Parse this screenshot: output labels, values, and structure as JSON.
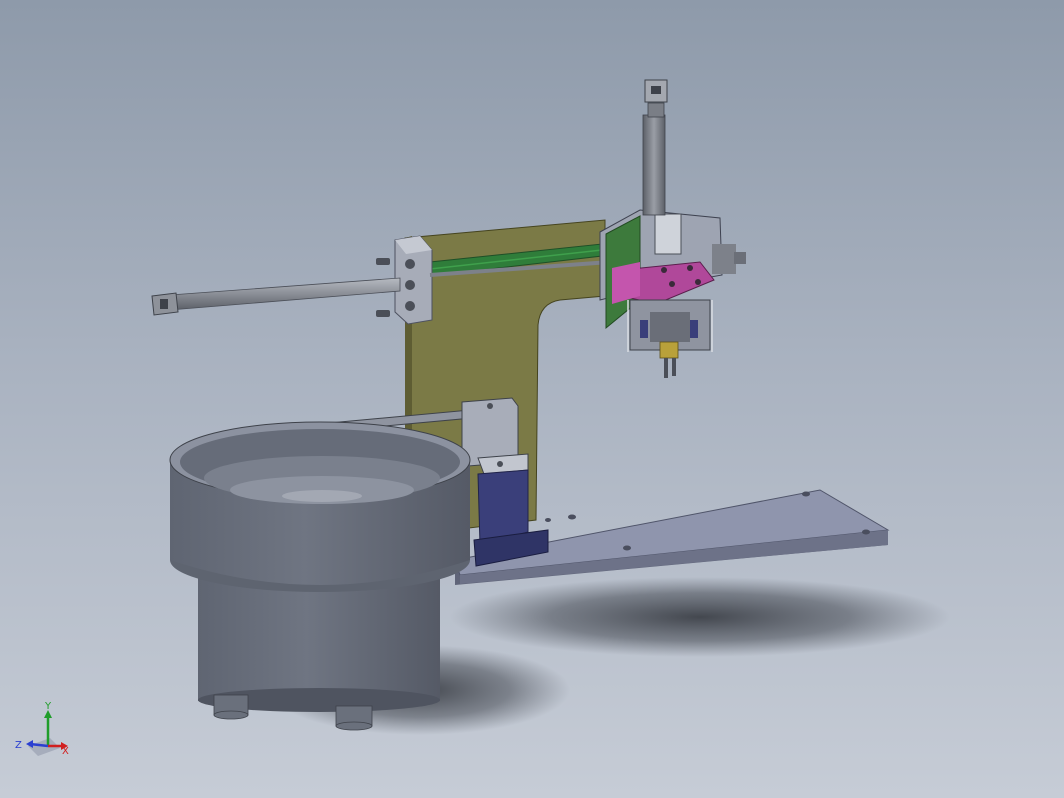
{
  "viewport": {
    "background_top": "#8e9aaa",
    "background_bottom": "#c6ccd6"
  },
  "model": {
    "parts": [
      "base-plate",
      "c-frame-column",
      "linear-rail",
      "horizontal-cylinder",
      "vertical-cylinder",
      "slide-carriage",
      "pick-head",
      "vibratory-bowl",
      "bowl-drive-base",
      "feed-track",
      "track-support"
    ],
    "colors": {
      "frame": "#7b7a46",
      "rail": "#2f7d3a",
      "plate": "#8f95ad",
      "bowl": "#656b78",
      "carriage_accent": "#b0489a",
      "block": "#3a3f7a",
      "rod": "#8a8e96"
    }
  },
  "triad": {
    "x_label": "X",
    "y_label": "Y",
    "z_label": "Z",
    "x_color": "#d11f1f",
    "y_color": "#1f9d2a",
    "z_color": "#2a3fd1",
    "icon": "coordinate-triad-icon"
  }
}
